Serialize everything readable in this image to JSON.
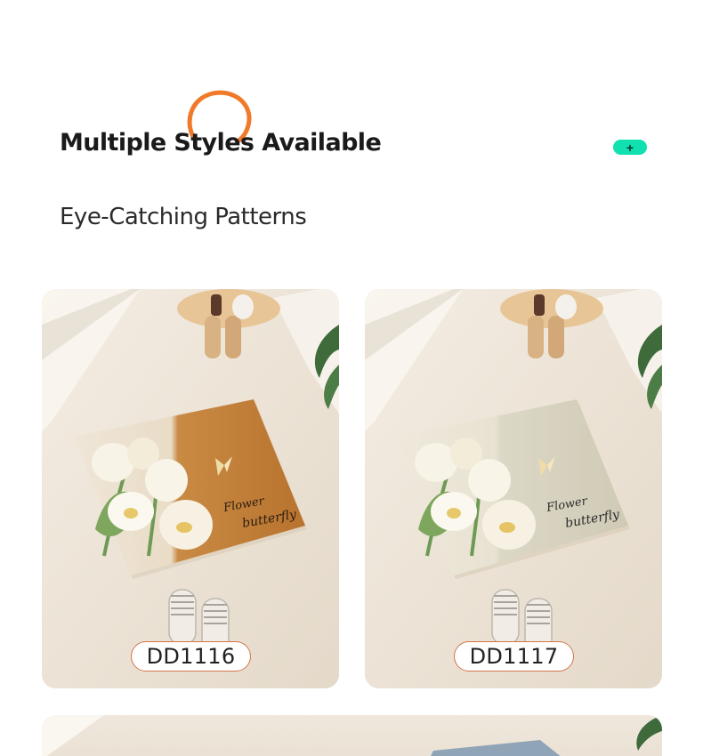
{
  "header": {
    "title": "Multiple Styles Available",
    "subtitle": "Eye-Catching Patterns",
    "plus_label": "+",
    "accent_color": "#f07a2a",
    "plus_color": "#11e0b0"
  },
  "products": [
    {
      "code": "DD1116",
      "mat_script_line1": "Flower",
      "mat_script_line2": "butterfly",
      "mat_color": "#c8843c"
    },
    {
      "code": "DD1117",
      "mat_script_line1": "Flower",
      "mat_script_line2": "butterfly",
      "mat_color": "#d4d0bf"
    }
  ]
}
